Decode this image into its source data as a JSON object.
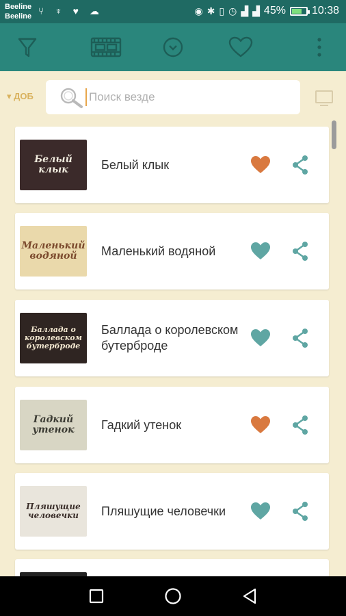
{
  "status_bar": {
    "carrier_1": "Beeline",
    "carrier_2": "Beeline",
    "battery": "45%",
    "time": "10:38"
  },
  "toolbar": {
    "icons": [
      "filter-icon",
      "filmstrip-icon",
      "clock-icon",
      "heart-icon",
      "more-vert-icon"
    ],
    "accent": "#2a867c"
  },
  "search": {
    "sort_label": "▾ ДОБ",
    "placeholder": "Поиск везде",
    "value": ""
  },
  "items": [
    {
      "title": "Белый клык",
      "thumb_text": "Белый клык",
      "favorite": true
    },
    {
      "title": "Маленький водяной",
      "thumb_text": "Маленький водяной",
      "favorite": false
    },
    {
      "title": "Баллада о королевском бутерброде",
      "thumb_text": "Баллада о королевском бутерброде",
      "favorite": false
    },
    {
      "title": "Гадкий утенок",
      "thumb_text": "Гадкий утенок",
      "favorite": true
    },
    {
      "title": "Пляшущие человечки",
      "thumb_text": "Пляшущие человечки",
      "favorite": false
    }
  ],
  "colors": {
    "favorite_on": "#d9793f",
    "favorite_off": "#5fa6a3",
    "share": "#5fa6a3",
    "background": "#f5edd1"
  }
}
